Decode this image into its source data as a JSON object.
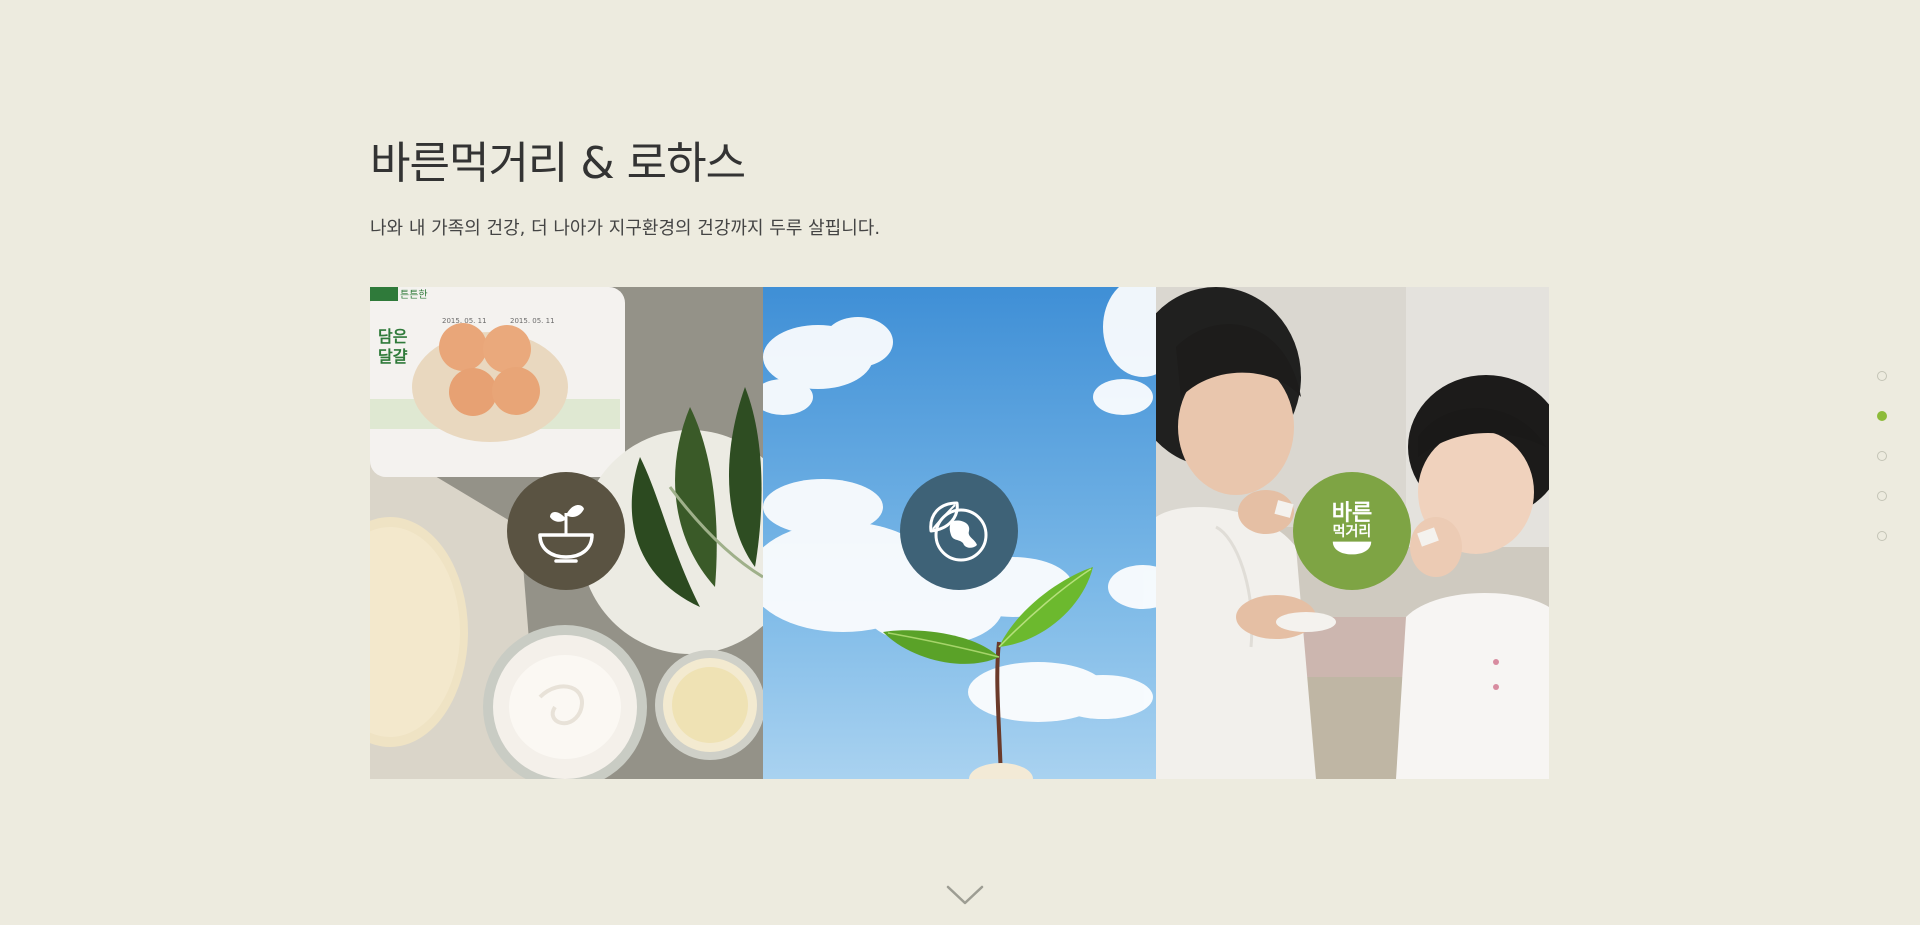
{
  "section": {
    "title": "바른먹거리 & 로하스",
    "description": "나와 내 가족의 건강, 더 나아가 지구환경의 건강까지 두루 살핍니다."
  },
  "panels": [
    {
      "name": "food",
      "icon": "sprout-bowl-icon",
      "badge_color": "#5a5342"
    },
    {
      "name": "environment",
      "icon": "leaf-globe-icon",
      "badge_color": "#3e6277"
    },
    {
      "name": "family",
      "icon": "bareun-meokgeori-logo",
      "badge_color": "#7ea444",
      "badge_text_line1": "바른",
      "badge_text_line2": "먹거리"
    }
  ],
  "egg_pack": {
    "brand": "튼튼한",
    "label_line1": "담은",
    "label_line2": "달걀",
    "date_line1": "2015. 05. 11",
    "date_line2": "2015. 05. 11"
  },
  "dot_nav": {
    "count": 5,
    "active_index": 1,
    "active_color": "#8dbb3a"
  },
  "scroll_icon": "chevron-down-icon"
}
